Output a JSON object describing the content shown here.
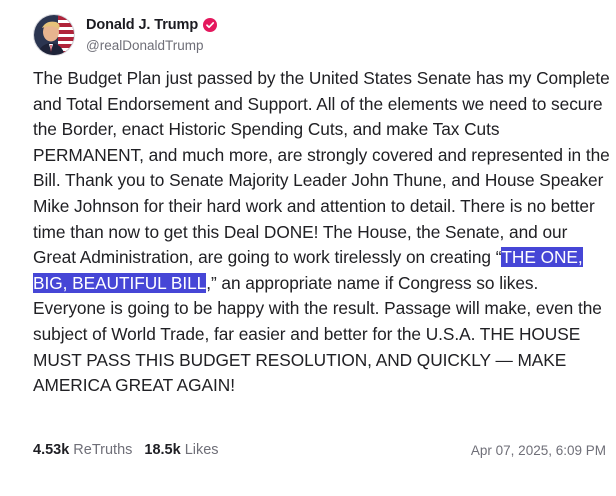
{
  "author": {
    "display_name": "Donald J. Trump",
    "handle": "@realDonaldTrump",
    "avatar_icon": "user-avatar",
    "verified_icon": "verified-badge-icon",
    "verified_color": "#e4185d"
  },
  "post": {
    "text_before": "The Budget Plan just passed by the United States Senate has my Complete and Total Endorsement and Support. All of the elements we need to secure the Border, enact Historic Spending Cuts, and make Tax Cuts PERMANENT, and much more, are strongly covered and represented in the Bill. Thank you to Senate Majority Leader John Thune, and House Speaker Mike Johnson for their hard work and attention to detail. There is no better time than now to get this Deal DONE! The House, the Senate, and our Great Administration, are going to work tirelessly on creating “",
    "text_highlighted": "THE ONE, BIG, BEAUTIFUL BILL",
    "text_after": ",” an appropriate name if Congress so likes. Everyone is going to be happy with the result. Passage will make, even the subject of World Trade, far easier and better for the U.S.A. THE HOUSE MUST PASS THIS BUDGET RESOLUTION, AND QUICKLY — MAKE AMERICA GREAT AGAIN!",
    "highlight_color": "#4646d6"
  },
  "footer": {
    "retruths_count": "4.53k",
    "retruths_label": "ReTruths",
    "likes_count": "18.5k",
    "likes_label": "Likes",
    "timestamp": "Apr 07, 2025, 6:09 PM"
  }
}
